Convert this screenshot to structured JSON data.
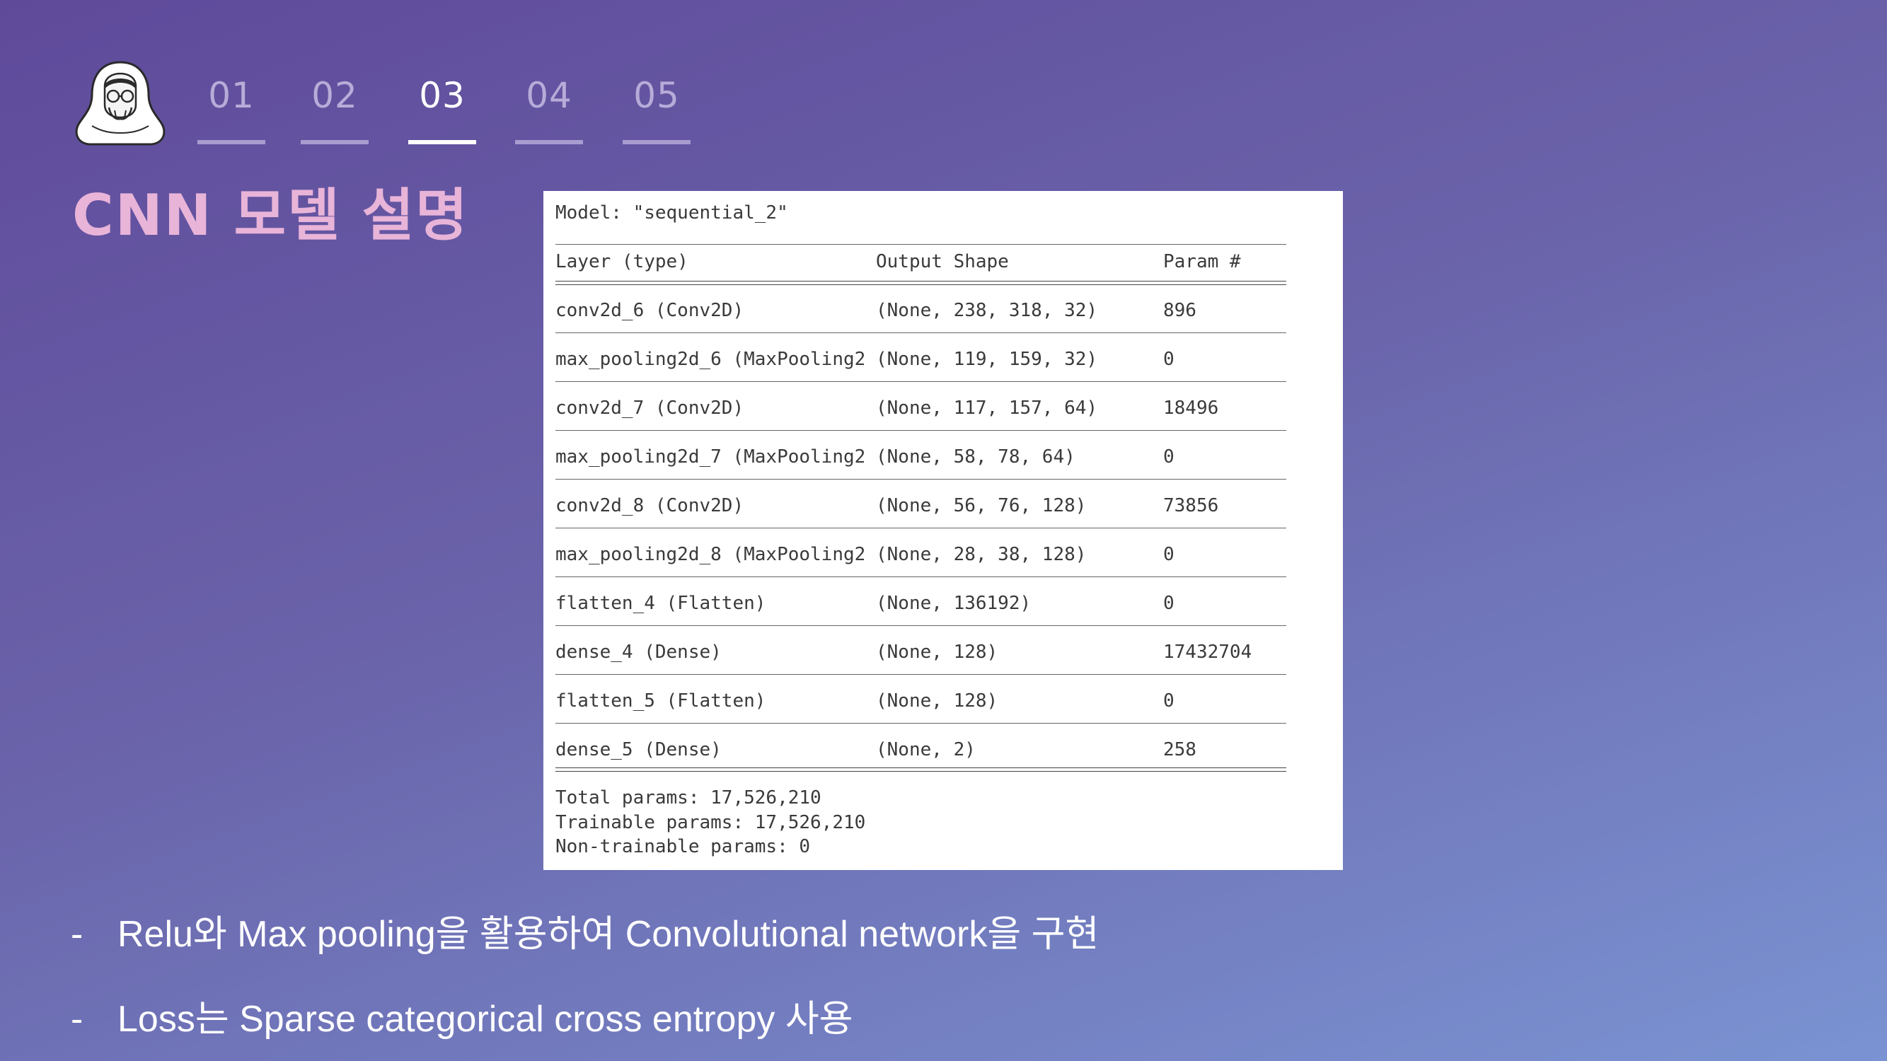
{
  "nav": {
    "tabs": [
      {
        "label": "01",
        "active": false
      },
      {
        "label": "02",
        "active": false
      },
      {
        "label": "03",
        "active": true
      },
      {
        "label": "04",
        "active": false
      },
      {
        "label": "05",
        "active": false
      }
    ]
  },
  "title": "CNN 모델 설명",
  "summary": {
    "model_line": "Model: \"sequential_2\"",
    "headers": {
      "layer": "Layer (type)",
      "output_shape": "Output Shape",
      "param": "Param #"
    },
    "rows": [
      {
        "layer": "conv2d_6 (Conv2D)",
        "output_shape": "(None, 238, 318, 32)",
        "param": "896"
      },
      {
        "layer": "max_pooling2d_6 (MaxPooling2",
        "output_shape": "(None, 119, 159, 32)",
        "param": "0"
      },
      {
        "layer": "conv2d_7 (Conv2D)",
        "output_shape": "(None, 117, 157, 64)",
        "param": "18496"
      },
      {
        "layer": "max_pooling2d_7 (MaxPooling2",
        "output_shape": "(None, 58, 78, 64)",
        "param": "0"
      },
      {
        "layer": "conv2d_8 (Conv2D)",
        "output_shape": "(None, 56, 76, 128)",
        "param": "73856"
      },
      {
        "layer": "max_pooling2d_8 (MaxPooling2",
        "output_shape": "(None, 28, 38, 128)",
        "param": "0"
      },
      {
        "layer": "flatten_4 (Flatten)",
        "output_shape": "(None, 136192)",
        "param": "0"
      },
      {
        "layer": "dense_4 (Dense)",
        "output_shape": "(None, 128)",
        "param": "17432704"
      },
      {
        "layer": "flatten_5 (Flatten)",
        "output_shape": "(None, 128)",
        "param": "0"
      },
      {
        "layer": "dense_5 (Dense)",
        "output_shape": "(None, 2)",
        "param": "258"
      }
    ],
    "total_params": "Total params: 17,526,210",
    "trainable_params": "Trainable params: 17,526,210",
    "non_trainable_params": "Non-trainable params: 0"
  },
  "bullets": [
    {
      "dash": "-",
      "text": "Relu와 Max pooling을 활용하여 Convolutional network을 구현"
    },
    {
      "dash": "-",
      "text": "Loss는 Sparse categorical cross entropy 사용"
    }
  ],
  "colors": {
    "title": "#e8b4d8",
    "active_tab": "#ffffff",
    "inactive_tab": "#b7acd8"
  },
  "icons": {
    "mascot": "hooded-character-icon"
  }
}
